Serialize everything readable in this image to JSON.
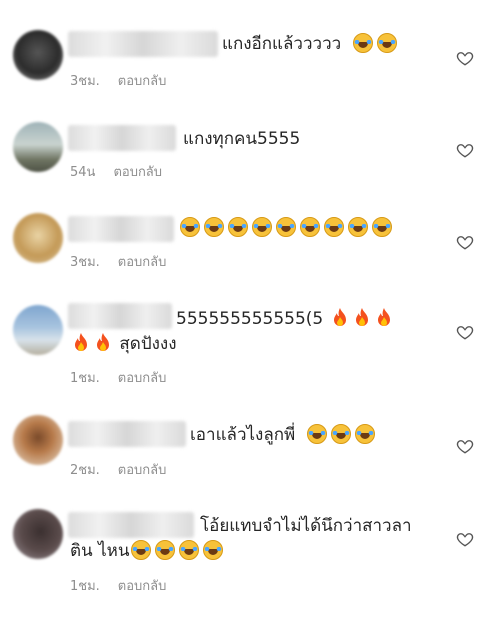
{
  "heart_icon": "heart-outline-icon",
  "emoji_icons": {
    "laugh": "face-with-tears-of-joy-icon",
    "fire": "fire-icon"
  },
  "colors": {
    "text": "#262626",
    "meta": "#8e8e8e",
    "emoji": "#f7c23a"
  },
  "comments": [
    {
      "text": "แกงอีกแล้ววววว",
      "laugh_count": 2,
      "time": "3ชม.",
      "reply_label": "ตอบกลับ"
    },
    {
      "text": "แกงทุกคน5555",
      "time": "54น",
      "reply_label": "ตอบกลับ"
    },
    {
      "text": "",
      "laugh_count": 9,
      "time": "3ชม.",
      "reply_label": "ตอบกลับ"
    },
    {
      "text": "555555555555(5",
      "fire_count": 5,
      "text_line2": "สุดปังงง",
      "time": "1ชม.",
      "reply_label": "ตอบกลับ"
    },
    {
      "text": "เอาแล้วไงลูกพี่",
      "laugh_count": 3,
      "time": "2ชม.",
      "reply_label": "ตอบกลับ"
    },
    {
      "text": "โอ้ยแทบจำไม่ได้นึกว่าสาวลา",
      "text_line2": "ติน ไหน",
      "laugh_count": 4,
      "time": "1ชม.",
      "reply_label": "ตอบกลับ"
    }
  ]
}
